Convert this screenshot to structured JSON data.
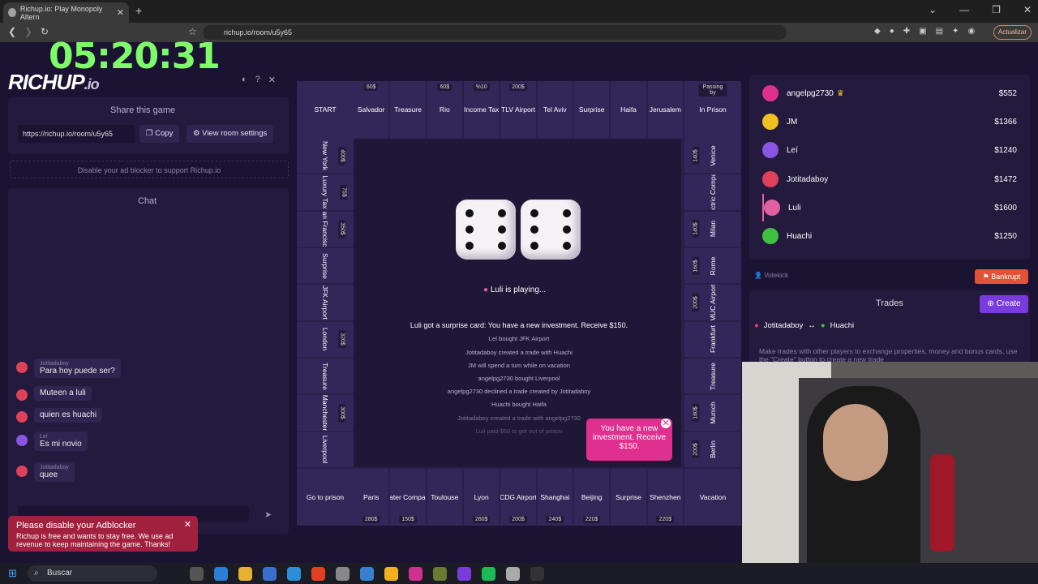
{
  "browser": {
    "tab_title": "Richup.io: Play Monopoly Altern",
    "url": "richup.io/room/u5y65",
    "update_label": "Actualizar"
  },
  "overlay": {
    "timer": "05:20:31"
  },
  "app": {
    "logo": "RICHUP",
    "logo_suffix": ".io",
    "share_title": "Share this game",
    "share_url": "https://richup.io/room/u5y65",
    "copy_label": "Copy",
    "room_settings_label": "View room settings",
    "ad_note": "Disable your ad blocker to support Richup.io",
    "chat_title": "Chat",
    "chat_messages": [
      {
        "user": "Jotitadaboy",
        "text": "Para hoy puede ser?",
        "color": "#e0405a"
      },
      {
        "user": "",
        "text": "Muteen a luli",
        "color": "#e0405a"
      },
      {
        "user": "",
        "text": "quien es huachi",
        "color": "#e0405a"
      },
      {
        "user": "Leí",
        "text": "Es mi novio",
        "color": "#8a55e0"
      },
      {
        "user": "Jotitadaboy",
        "text": "quee",
        "color": "#e0405a"
      }
    ],
    "ad_popup_title": "Please disable your Adblocker",
    "ad_popup_text": "Richup is free and wants to stay free. We use ad revenue to keep maintaining the game. Thanks!"
  },
  "board": {
    "top": [
      {
        "name": "START",
        "price": ""
      },
      {
        "name": "Salvador",
        "price": "60$"
      },
      {
        "name": "Treasure",
        "price": ""
      },
      {
        "name": "Rio",
        "price": "60$"
      },
      {
        "name": "Income Tax",
        "price": "%10"
      },
      {
        "name": "TLV Airport",
        "price": "200$"
      },
      {
        "name": "Tel Aviv",
        "price": ""
      },
      {
        "name": "Surprise",
        "price": ""
      },
      {
        "name": "Haifa",
        "price": ""
      },
      {
        "name": "Jerusalem",
        "price": ""
      },
      {
        "name": "In Prison",
        "price": "Passing by"
      }
    ],
    "left": [
      {
        "name": "New York",
        "price": "400$"
      },
      {
        "name": "Luxury Tax",
        "price": "75$"
      },
      {
        "name": "San Francisco",
        "price": "350$"
      },
      {
        "name": "Surprise",
        "price": ""
      },
      {
        "name": "JFK Airport",
        "price": ""
      },
      {
        "name": "London",
        "price": "320$"
      },
      {
        "name": "Treasure",
        "price": ""
      },
      {
        "name": "Manchester",
        "price": "300$"
      },
      {
        "name": "Liverpool",
        "price": ""
      }
    ],
    "right": [
      {
        "name": "Venice",
        "price": "140$"
      },
      {
        "name": "Electric Company",
        "price": ""
      },
      {
        "name": "Milan",
        "price": "140$"
      },
      {
        "name": "Rome",
        "price": "160$"
      },
      {
        "name": "MUC Airport",
        "price": "200$"
      },
      {
        "name": "Frankfurt",
        "price": ""
      },
      {
        "name": "Treasure",
        "price": ""
      },
      {
        "name": "Munich",
        "price": "180$"
      },
      {
        "name": "Berlin",
        "price": "200$"
      }
    ],
    "bottom": [
      {
        "name": "Go to prison",
        "price": ""
      },
      {
        "name": "Paris",
        "price": "280$"
      },
      {
        "name": "Water Company",
        "price": "150$"
      },
      {
        "name": "Toulouse",
        "price": ""
      },
      {
        "name": "Lyon",
        "price": "260$"
      },
      {
        "name": "CDG Airport",
        "price": "200$"
      },
      {
        "name": "Shanghai",
        "price": "240$"
      },
      {
        "name": "Beijing",
        "price": "220$"
      },
      {
        "name": "Surprise",
        "price": ""
      },
      {
        "name": "Shenzhen",
        "price": "220$"
      },
      {
        "name": "Vacation",
        "price": ""
      }
    ],
    "playing_name": "Luli",
    "playing_text": "is playing...",
    "log_main": "Luli  got a surprise card: You have a new investment. Receive $150.",
    "log": [
      "Leí  bought  JFK Airport",
      "Jotitadaboy  created a trade with  Huachi",
      "JM  will spend a turn while on vacation",
      "angelpg2730  bought  Liverpool",
      "angelpg2730  declined a trade created by  Jotitadaboy",
      "Huachi  bought  Haifa",
      "Jotitadaboy  created a trade with  angelpg2730",
      "Luli  paid $50 to get out of prison"
    ],
    "invest_toast": "You have a new investment. Receive $150."
  },
  "players": [
    {
      "name": "angelpg2730",
      "money": "$552",
      "color": "#e0308f"
    },
    {
      "name": "JM",
      "money": "$1366",
      "color": "#f0c020"
    },
    {
      "name": "Leí",
      "money": "$1240",
      "color": "#8a55e0"
    },
    {
      "name": "Jotitadaboy",
      "money": "$1472",
      "color": "#e0405a"
    },
    {
      "name": "Luli",
      "money": "$1600",
      "color": "#e060a0"
    },
    {
      "name": "Huachi",
      "money": "$1250",
      "color": "#40c040"
    }
  ],
  "controls": {
    "votekick": "Votekick",
    "bankrupt": "Bankrupt",
    "trades_title": "Trades",
    "create_label": "Create",
    "trade_from": "Jotitadaboy",
    "trade_arrow": "↔",
    "trade_to": "Huachi",
    "trade_hint": "Make trades with other players to exchange properties, money and bonus cards, use the \"Create\" button to create a new trade"
  },
  "taskbar": {
    "search": "Buscar"
  }
}
